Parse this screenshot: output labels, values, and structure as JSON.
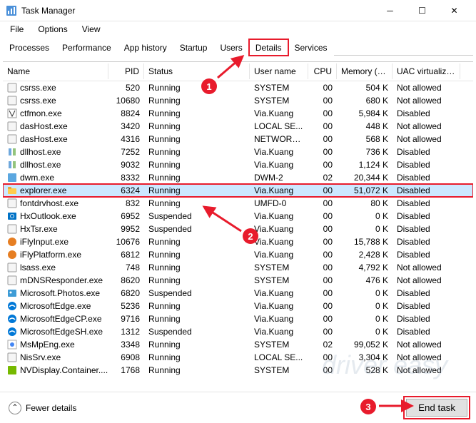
{
  "window": {
    "title": "Task Manager"
  },
  "menu": {
    "file": "File",
    "options": "Options",
    "view": "View"
  },
  "tabs": {
    "items": [
      "Processes",
      "Performance",
      "App history",
      "Startup",
      "Users",
      "Details",
      "Services"
    ],
    "active": 5
  },
  "columns": {
    "name": "Name",
    "pid": "PID",
    "status": "Status",
    "user": "User name",
    "cpu": "CPU",
    "mem": "Memory (a...",
    "uac": "UAC virtualizat..."
  },
  "rows": [
    {
      "name": "csrss.exe",
      "pid": "520",
      "status": "Running",
      "user": "SYSTEM",
      "cpu": "00",
      "mem": "504 K",
      "uac": "Not allowed",
      "icon": "generic"
    },
    {
      "name": "csrss.exe",
      "pid": "10680",
      "status": "Running",
      "user": "SYSTEM",
      "cpu": "00",
      "mem": "680 K",
      "uac": "Not allowed",
      "icon": "generic"
    },
    {
      "name": "ctfmon.exe",
      "pid": "8824",
      "status": "Running",
      "user": "Via.Kuang",
      "cpu": "00",
      "mem": "5,984 K",
      "uac": "Disabled",
      "icon": "ctfmon"
    },
    {
      "name": "dasHost.exe",
      "pid": "3420",
      "status": "Running",
      "user": "LOCAL SE...",
      "cpu": "00",
      "mem": "448 K",
      "uac": "Not allowed",
      "icon": "generic"
    },
    {
      "name": "dasHost.exe",
      "pid": "4316",
      "status": "Running",
      "user": "NETWORK...",
      "cpu": "00",
      "mem": "568 K",
      "uac": "Not allowed",
      "icon": "generic"
    },
    {
      "name": "dllhost.exe",
      "pid": "7252",
      "status": "Running",
      "user": "Via.Kuang",
      "cpu": "00",
      "mem": "736 K",
      "uac": "Disabled",
      "icon": "dllhost"
    },
    {
      "name": "dllhost.exe",
      "pid": "9032",
      "status": "Running",
      "user": "Via.Kuang",
      "cpu": "00",
      "mem": "1,124 K",
      "uac": "Disabled",
      "icon": "dllhost"
    },
    {
      "name": "dwm.exe",
      "pid": "8332",
      "status": "Running",
      "user": "DWM-2",
      "cpu": "02",
      "mem": "20,344 K",
      "uac": "Disabled",
      "icon": "dwm"
    },
    {
      "name": "explorer.exe",
      "pid": "6324",
      "status": "Running",
      "user": "Via.Kuang",
      "cpu": "00",
      "mem": "51,072 K",
      "uac": "Disabled",
      "icon": "explorer",
      "selected": true
    },
    {
      "name": "fontdrvhost.exe",
      "pid": "832",
      "status": "Running",
      "user": "UMFD-0",
      "cpu": "00",
      "mem": "80 K",
      "uac": "Disabled",
      "icon": "generic"
    },
    {
      "name": "HxOutlook.exe",
      "pid": "6952",
      "status": "Suspended",
      "user": "Via.Kuang",
      "cpu": "00",
      "mem": "0 K",
      "uac": "Disabled",
      "icon": "outlook"
    },
    {
      "name": "HxTsr.exe",
      "pid": "9952",
      "status": "Suspended",
      "user": "Via.Kuang",
      "cpu": "00",
      "mem": "0 K",
      "uac": "Disabled",
      "icon": "generic"
    },
    {
      "name": "iFlyInput.exe",
      "pid": "10676",
      "status": "Running",
      "user": "Via.Kuang",
      "cpu": "00",
      "mem": "15,788 K",
      "uac": "Disabled",
      "icon": "ifly"
    },
    {
      "name": "iFlyPlatform.exe",
      "pid": "6812",
      "status": "Running",
      "user": "Via.Kuang",
      "cpu": "00",
      "mem": "2,428 K",
      "uac": "Disabled",
      "icon": "ifly"
    },
    {
      "name": "lsass.exe",
      "pid": "748",
      "status": "Running",
      "user": "SYSTEM",
      "cpu": "00",
      "mem": "4,792 K",
      "uac": "Not allowed",
      "icon": "generic"
    },
    {
      "name": "mDNSResponder.exe",
      "pid": "8620",
      "status": "Running",
      "user": "SYSTEM",
      "cpu": "00",
      "mem": "476 K",
      "uac": "Not allowed",
      "icon": "generic"
    },
    {
      "name": "Microsoft.Photos.exe",
      "pid": "6820",
      "status": "Suspended",
      "user": "Via.Kuang",
      "cpu": "00",
      "mem": "0 K",
      "uac": "Disabled",
      "icon": "photos"
    },
    {
      "name": "MicrosoftEdge.exe",
      "pid": "5236",
      "status": "Running",
      "user": "Via.Kuang",
      "cpu": "00",
      "mem": "0 K",
      "uac": "Disabled",
      "icon": "edge"
    },
    {
      "name": "MicrosoftEdgeCP.exe",
      "pid": "9716",
      "status": "Running",
      "user": "Via.Kuang",
      "cpu": "00",
      "mem": "0 K",
      "uac": "Disabled",
      "icon": "edge"
    },
    {
      "name": "MicrosoftEdgeSH.exe",
      "pid": "1312",
      "status": "Suspended",
      "user": "Via.Kuang",
      "cpu": "00",
      "mem": "0 K",
      "uac": "Disabled",
      "icon": "edge"
    },
    {
      "name": "MsMpEng.exe",
      "pid": "3348",
      "status": "Running",
      "user": "SYSTEM",
      "cpu": "02",
      "mem": "99,052 K",
      "uac": "Not allowed",
      "icon": "msmp"
    },
    {
      "name": "NisSrv.exe",
      "pid": "6908",
      "status": "Running",
      "user": "LOCAL SE...",
      "cpu": "00",
      "mem": "3,304 K",
      "uac": "Not allowed",
      "icon": "generic"
    },
    {
      "name": "NVDisplay.Container....",
      "pid": "1768",
      "status": "Running",
      "user": "SYSTEM",
      "cpu": "00",
      "mem": "528 K",
      "uac": "Not allowed",
      "icon": "nvidia"
    }
  ],
  "footer": {
    "fewer": "Fewer details",
    "endtask": "End task"
  },
  "annotations": {
    "b1": "1",
    "b2": "2",
    "b3": "3"
  },
  "watermark": "driver easy"
}
